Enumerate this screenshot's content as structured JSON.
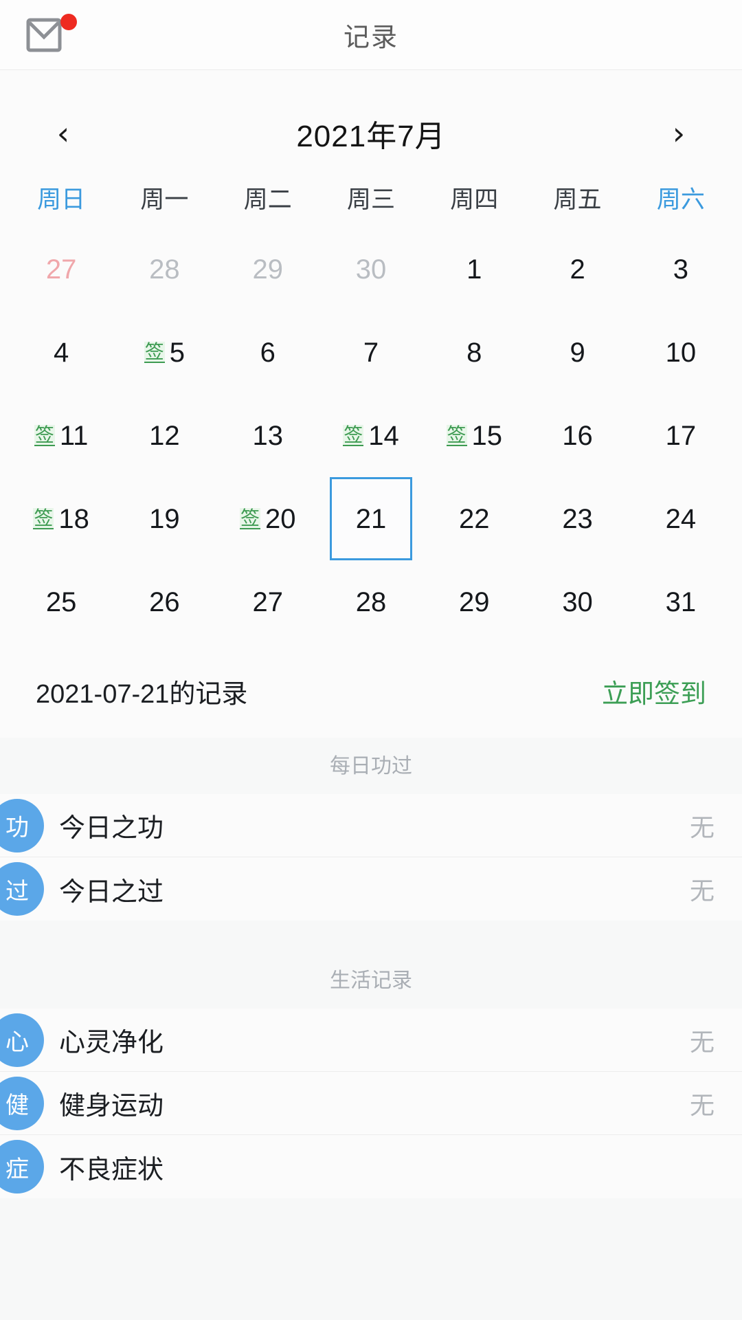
{
  "header": {
    "title": "记录",
    "mail_icon": "envelope-icon",
    "badge": "notification-dot"
  },
  "calendar": {
    "prev_label": "‹",
    "next_label": "›",
    "month_label": "2021年7月",
    "weekdays": [
      "周日",
      "周一",
      "周二",
      "周三",
      "周四",
      "周五",
      "周六"
    ],
    "sign_mark": "签",
    "weeks": [
      [
        {
          "day": "27",
          "out": true,
          "sign": false
        },
        {
          "day": "28",
          "out": true,
          "sign": false
        },
        {
          "day": "29",
          "out": true,
          "sign": false
        },
        {
          "day": "30",
          "out": true,
          "sign": false
        },
        {
          "day": "1",
          "out": false,
          "sign": false
        },
        {
          "day": "2",
          "out": false,
          "sign": false
        },
        {
          "day": "3",
          "out": false,
          "sign": false
        }
      ],
      [
        {
          "day": "4",
          "out": false,
          "sign": false
        },
        {
          "day": "5",
          "out": false,
          "sign": true
        },
        {
          "day": "6",
          "out": false,
          "sign": false
        },
        {
          "day": "7",
          "out": false,
          "sign": false
        },
        {
          "day": "8",
          "out": false,
          "sign": false
        },
        {
          "day": "9",
          "out": false,
          "sign": false
        },
        {
          "day": "10",
          "out": false,
          "sign": false
        }
      ],
      [
        {
          "day": "11",
          "out": false,
          "sign": true
        },
        {
          "day": "12",
          "out": false,
          "sign": false
        },
        {
          "day": "13",
          "out": false,
          "sign": false
        },
        {
          "day": "14",
          "out": false,
          "sign": true
        },
        {
          "day": "15",
          "out": false,
          "sign": true
        },
        {
          "day": "16",
          "out": false,
          "sign": false
        },
        {
          "day": "17",
          "out": false,
          "sign": false
        }
      ],
      [
        {
          "day": "18",
          "out": false,
          "sign": true
        },
        {
          "day": "19",
          "out": false,
          "sign": false
        },
        {
          "day": "20",
          "out": false,
          "sign": true
        },
        {
          "day": "21",
          "out": false,
          "sign": false,
          "selected": true
        },
        {
          "day": "22",
          "out": false,
          "sign": false
        },
        {
          "day": "23",
          "out": false,
          "sign": false
        },
        {
          "day": "24",
          "out": false,
          "sign": false
        }
      ],
      [
        {
          "day": "25",
          "out": false,
          "sign": false
        },
        {
          "day": "26",
          "out": false,
          "sign": false
        },
        {
          "day": "27",
          "out": false,
          "sign": false
        },
        {
          "day": "28",
          "out": false,
          "sign": false
        },
        {
          "day": "29",
          "out": false,
          "sign": false
        },
        {
          "day": "30",
          "out": false,
          "sign": false
        },
        {
          "day": "31",
          "out": false,
          "sign": false
        }
      ]
    ]
  },
  "record": {
    "title": "2021-07-21的记录",
    "action": "立即签到"
  },
  "sections": [
    {
      "heading": "每日功过",
      "items": [
        {
          "avatar": "功",
          "label": "今日之功",
          "value": "无"
        },
        {
          "avatar": "过",
          "label": "今日之过",
          "value": "无"
        }
      ]
    },
    {
      "heading": "生活记录",
      "items": [
        {
          "avatar": "心",
          "label": "心灵净化",
          "value": "无"
        },
        {
          "avatar": "健",
          "label": "健身运动",
          "value": "无"
        },
        {
          "avatar": "症",
          "label": "不良症状",
          "value": ""
        }
      ]
    }
  ],
  "colors": {
    "accent_blue": "#3b9ade",
    "avatar_blue": "#5ba7e8",
    "sign_green": "#3e9b52",
    "action_green": "#3c9e55",
    "badge_red": "#ee2b21",
    "muted": "#b2b6bb"
  }
}
